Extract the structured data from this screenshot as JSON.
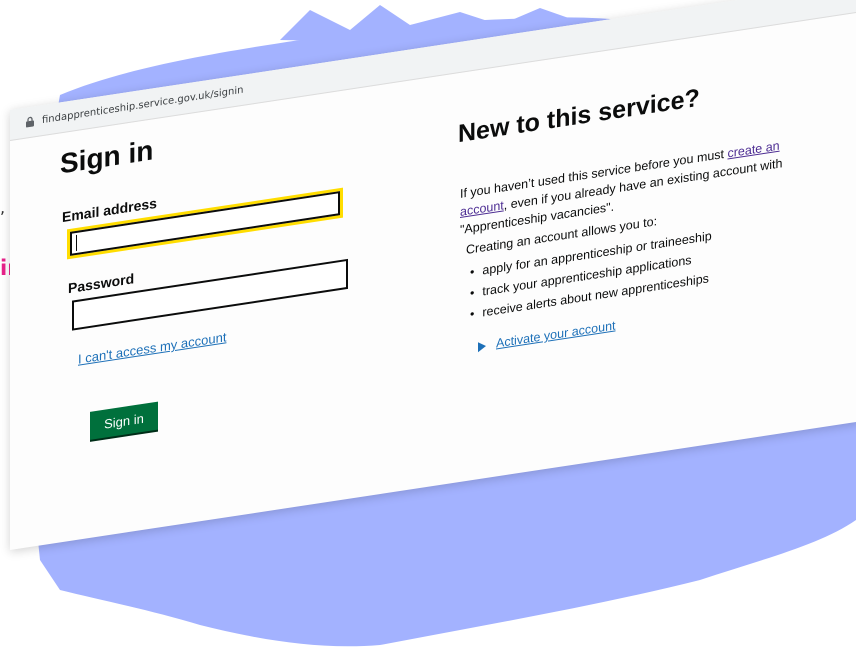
{
  "browser": {
    "url": "findapprenticeship.service.gov.uk/signin"
  },
  "signin": {
    "title": "Sign in",
    "email_label": "Email address",
    "email_value": "",
    "password_label": "Password",
    "password_value": "",
    "cant_access_link": "I can't access my account",
    "submit_label": "Sign in"
  },
  "new_service": {
    "title": "New to this service?",
    "intro_before": "If you haven’t used this service before you must ",
    "create_account_link": "create an account",
    "intro_after": ", even if you already have an existing account with \"Apprenticeship vacancies\".",
    "allows_heading": "Creating an account allows you to:",
    "benefits": [
      "apply for an apprenticeship or traineeship",
      "track your apprenticeship applications",
      "receive alerts about new apprenticeships"
    ],
    "activate_link": "Activate your account"
  },
  "edge_fragment": {
    "pink_text": "in",
    "comma": ","
  },
  "colors": {
    "splash_background": "#a3b2ff",
    "focus_yellow": "#ffdd00",
    "button_green": "#00703c",
    "link_blue": "#1d70b8",
    "visited_purple": "#4c2c92",
    "pink_accent": "#e8228a"
  },
  "icons": {
    "lock": "lock-icon",
    "details_toggle": "triangle-right-icon"
  }
}
